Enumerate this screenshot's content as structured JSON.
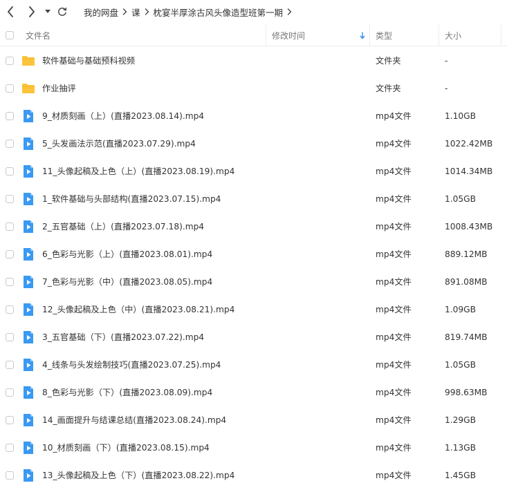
{
  "breadcrumb": [
    "我的网盘",
    "课",
    "枕宴半厚涂古风头像造型班第一期"
  ],
  "columns": {
    "name": "文件名",
    "modified": "修改时间",
    "type": "类型",
    "size": "大小"
  },
  "rows": [
    {
      "name": "软件基础与基础预科视频",
      "type": "文件夹",
      "size": "-",
      "kind": "folder"
    },
    {
      "name": "作业抽评",
      "type": "文件夹",
      "size": "-",
      "kind": "folder"
    },
    {
      "name": "9_材质刻画（上）(直播2023.08.14).mp4",
      "type": "mp4文件",
      "size": "1.10GB",
      "kind": "video"
    },
    {
      "name": "5_头发画法示范(直播2023.07.29).mp4",
      "type": "mp4文件",
      "size": "1022.42MB",
      "kind": "video"
    },
    {
      "name": "11_头像起稿及上色（上）(直播2023.08.19).mp4",
      "type": "mp4文件",
      "size": "1014.34MB",
      "kind": "video"
    },
    {
      "name": "1_软件基础与头部结构(直播2023.07.15).mp4",
      "type": "mp4文件",
      "size": "1.05GB",
      "kind": "video"
    },
    {
      "name": "2_五官基础（上）(直播2023.07.18).mp4",
      "type": "mp4文件",
      "size": "1008.43MB",
      "kind": "video"
    },
    {
      "name": "6_色彩与光影（上）(直播2023.08.01).mp4",
      "type": "mp4文件",
      "size": "889.12MB",
      "kind": "video"
    },
    {
      "name": "7_色彩与光影（中）(直播2023.08.05).mp4",
      "type": "mp4文件",
      "size": "891.08MB",
      "kind": "video"
    },
    {
      "name": "12_头像起稿及上色（中）(直播2023.08.21).mp4",
      "type": "mp4文件",
      "size": "1.09GB",
      "kind": "video"
    },
    {
      "name": "3_五官基础（下）(直播2023.07.22).mp4",
      "type": "mp4文件",
      "size": "819.74MB",
      "kind": "video"
    },
    {
      "name": "4_线条与头发绘制技巧(直播2023.07.25).mp4",
      "type": "mp4文件",
      "size": "1.05GB",
      "kind": "video"
    },
    {
      "name": "8_色彩与光影（下）(直播2023.08.09).mp4",
      "type": "mp4文件",
      "size": "998.63MB",
      "kind": "video"
    },
    {
      "name": "14_画面提升与结课总结(直播2023.08.24).mp4",
      "type": "mp4文件",
      "size": "1.29GB",
      "kind": "video"
    },
    {
      "name": "10_材质刻画（下）(直播2023.08.15).mp4",
      "type": "mp4文件",
      "size": "1.13GB",
      "kind": "video"
    },
    {
      "name": "13_头像起稿及上色（下）(直播2023.08.22).mp4",
      "type": "mp4文件",
      "size": "1.45GB",
      "kind": "video"
    }
  ],
  "colors": {
    "folder": "#fbc43b",
    "video": "#3a99f2",
    "sort_arrow": "#2b8df2"
  },
  "icons": {
    "back": "chevron-left-icon",
    "forward": "chevron-right-icon",
    "history": "caret-down-icon",
    "refresh": "refresh-icon",
    "sort": "sort-down-arrow-icon",
    "folder": "folder-icon",
    "video": "video-file-icon"
  }
}
